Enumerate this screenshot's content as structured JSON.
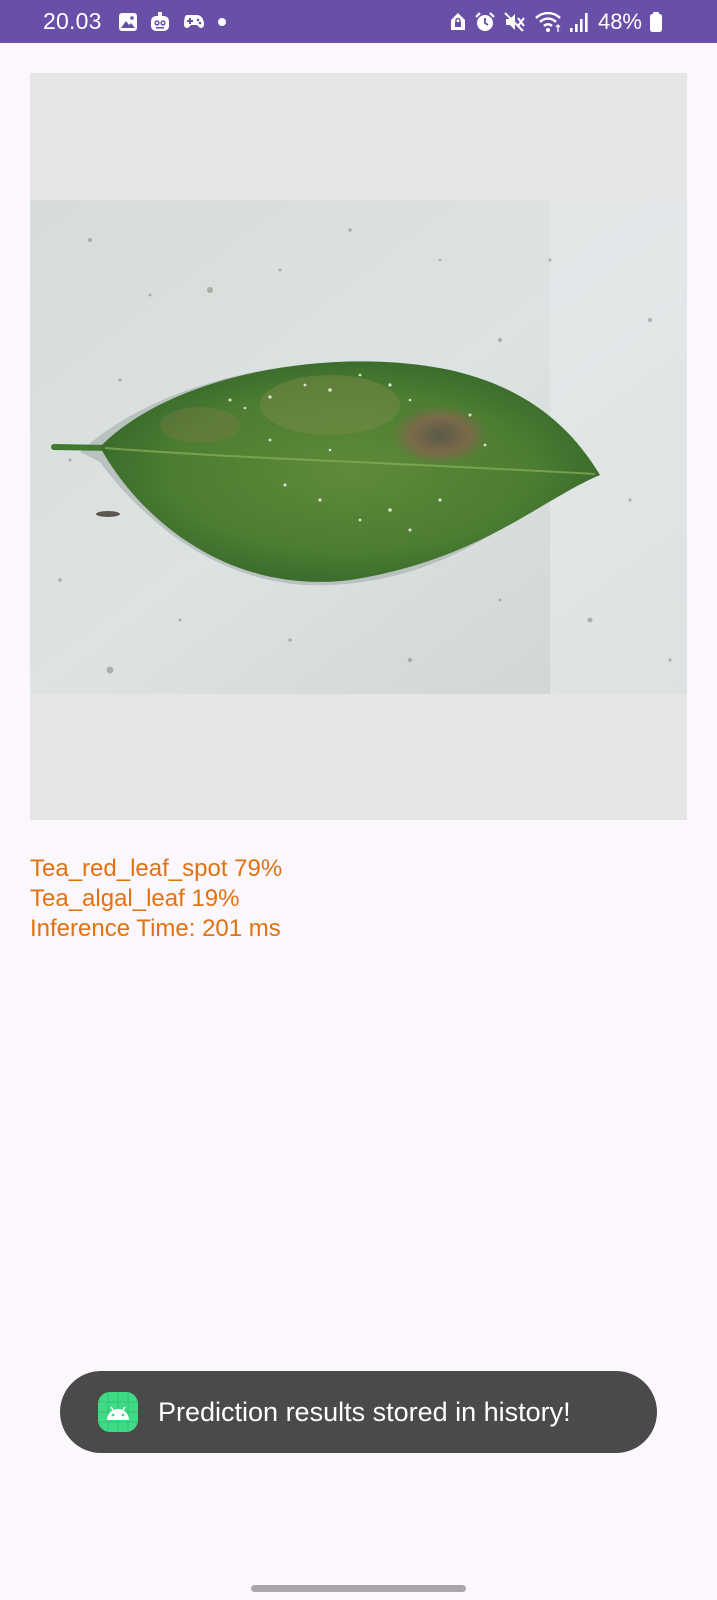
{
  "status_bar": {
    "time": "20.03",
    "battery": "48%",
    "left_icons": [
      "gallery-icon",
      "robot-app-icon",
      "game-controller-icon",
      "notification-dot-icon"
    ],
    "right_icons": [
      "vpn-lock-icon",
      "alarm-icon",
      "mute-icon",
      "wifi-icon",
      "signal-icon",
      "battery-icon"
    ],
    "background": "#6a4fa8"
  },
  "image_view": {
    "content": "tea leaf photo on concrete background",
    "background": "#e5e5e5"
  },
  "results": {
    "prediction_1": "Tea_red_leaf_spot 79%",
    "prediction_2": "Tea_algal_leaf 19%",
    "inference_time": "Inference Time: 201 ms",
    "color": "#e07212"
  },
  "toast": {
    "message": "Prediction results stored in history!",
    "icon": "android-app-icon",
    "icon_color": "#3ddc84"
  }
}
